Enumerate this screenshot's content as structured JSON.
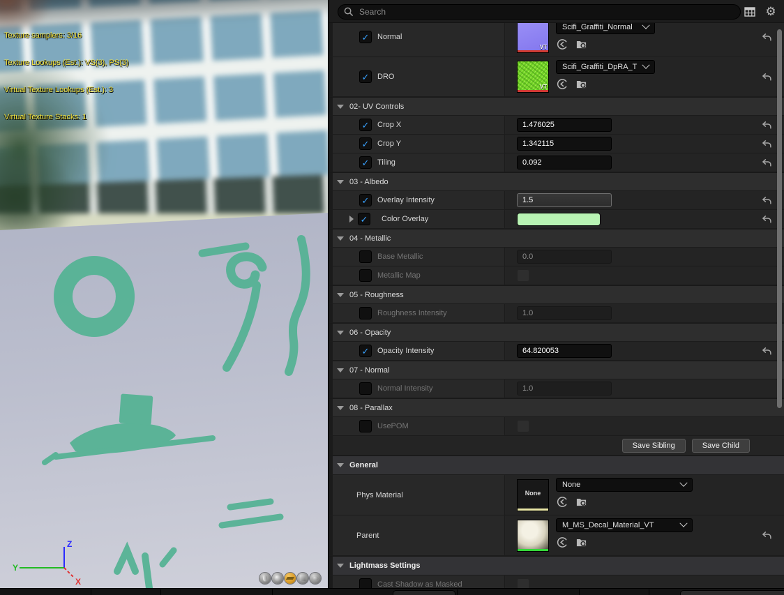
{
  "viewport": {
    "stats_lines": [
      "Texture samplers: 3/16",
      "Texture Lookups (Est.): VS(3), PS(3)",
      "Virtual Texture Lookups (Est.): 3",
      "Virtual Texture Stacks: 1"
    ],
    "axis_labels": {
      "x": "X",
      "y": "Y",
      "z": "Z"
    },
    "mesh_buttons": [
      {
        "name": "cylinder",
        "selected": false
      },
      {
        "name": "sphere",
        "selected": false
      },
      {
        "name": "plane",
        "selected": true
      },
      {
        "name": "cube",
        "selected": false
      },
      {
        "name": "teapot",
        "selected": false
      }
    ]
  },
  "toolbar": {
    "search_placeholder": "Search",
    "icons": [
      "display-filter-grid-icon",
      "settings-gear-icon"
    ]
  },
  "buttons": {
    "save_sibling": "Save Sibling",
    "save_child": "Save Child"
  },
  "colors": {
    "accent_check": "#38a1ff",
    "normal_thumb": "#8b80f2",
    "dro_thumb": "#72d426",
    "texture_strip": "#cf3b33",
    "phys_strip": "#e9e6a6",
    "parent_strip": "#35d73a",
    "color_overlay_swatch": "#b9f4b4",
    "selected_mesh_button": "#d89a27",
    "stats_text": "#f2e23c",
    "graffiti": "#53b293"
  },
  "rows": [
    {
      "type": "texture",
      "label": "Normal",
      "checked": true,
      "thumb": "normal",
      "vt_badge": "VT",
      "dropdown": "Scifi_Graffiti_Normal",
      "reset": true,
      "clip_top": true
    },
    {
      "type": "texture",
      "label": "DRO",
      "checked": true,
      "thumb": "dro",
      "vt_badge": "VT",
      "dropdown": "Scifi_Graffiti_DpRA_T",
      "reset": true
    },
    {
      "type": "section",
      "label": "02- UV Controls"
    },
    {
      "type": "scalar",
      "label": "Crop X",
      "checked": true,
      "value": "1.476025",
      "enabled": true,
      "reset": true
    },
    {
      "type": "scalar",
      "label": "Crop Y",
      "checked": true,
      "value": "1.342115",
      "enabled": true,
      "reset": true
    },
    {
      "type": "scalar",
      "label": "Tiling",
      "checked": true,
      "value": "0.092",
      "enabled": true,
      "reset": true
    },
    {
      "type": "section",
      "label": "03 - Albedo"
    },
    {
      "type": "scalar",
      "label": "Overlay Intensity",
      "checked": true,
      "value": "1.5",
      "enabled": true,
      "slider": true,
      "reset": true
    },
    {
      "type": "color",
      "label": "Color Overlay",
      "checked": true,
      "expander": true,
      "reset": true
    },
    {
      "type": "section",
      "label": "04 - Metallic"
    },
    {
      "type": "scalar",
      "label": "Base Metallic",
      "checked": false,
      "value": "0.0",
      "enabled": false
    },
    {
      "type": "check",
      "label": "Metallic Map",
      "checked": false,
      "enabled": false
    },
    {
      "type": "section",
      "label": "05 - Roughness"
    },
    {
      "type": "scalar",
      "label": "Roughness Intensity",
      "checked": false,
      "value": "1.0",
      "enabled": false
    },
    {
      "type": "section",
      "label": "06 - Opacity"
    },
    {
      "type": "scalar",
      "label": "Opacity Intensity",
      "checked": true,
      "value": "64.820053",
      "enabled": true,
      "reset": true
    },
    {
      "type": "section",
      "label": "07 - Normal"
    },
    {
      "type": "scalar",
      "label": "Normal Intensity",
      "checked": false,
      "value": "1.0",
      "enabled": false
    },
    {
      "type": "section",
      "label": "08 - Parallax"
    },
    {
      "type": "check",
      "label": "UsePOM",
      "checked": false,
      "enabled": false
    },
    {
      "type": "savebar"
    },
    {
      "type": "header",
      "label": "General"
    },
    {
      "type": "asset",
      "label": "Phys Material",
      "thumb": "phys",
      "thumb_text": "None",
      "dropdown": "None",
      "reset": false
    },
    {
      "type": "asset",
      "label": "Parent",
      "thumb": "parent",
      "dropdown": "M_MS_Decal_Material_VT",
      "reset": true
    },
    {
      "type": "header",
      "label": "Lightmass Settings"
    },
    {
      "type": "check",
      "label": "Cast Shadow as Masked",
      "checked": false,
      "enabled": false
    }
  ]
}
